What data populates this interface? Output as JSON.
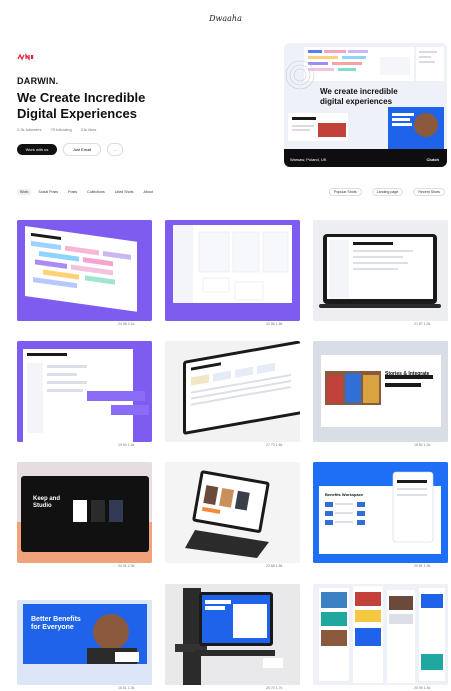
{
  "site": {
    "logo": "Dwaaha"
  },
  "profile": {
    "brand_name": "DARWIN.",
    "headline_line1": "We Create Incredible",
    "headline_line2": "Digital Experiences",
    "stats": [
      "2.3k followers",
      "75 following",
      "21k likes"
    ],
    "follow_label": "Work with us",
    "secondary_label": "Just Email",
    "more_label": "...",
    "accent": "#e5243b"
  },
  "hero": {
    "title": "We create incredible digital experiences",
    "caption": "Warsaw, Poland, UK",
    "tag": "Clutch"
  },
  "tabs": [
    "Work",
    "Social Posts",
    "Posts",
    "Collections",
    "Liked Shots",
    "About"
  ],
  "active_tab": "Work",
  "right_pills": [
    "Popular Shots",
    "Landing page",
    "Recent Shots"
  ],
  "shots": [
    {
      "stats": "24  98  2.1k"
    },
    {
      "stats": "32  86  1.8k"
    },
    {
      "stats": "21  57  1.3k"
    },
    {
      "stats": "19  64  1.4k"
    },
    {
      "stats": "27  73  1.6k"
    },
    {
      "stats": "16  52  1.2k"
    },
    {
      "stats": "34  91  2.3k"
    },
    {
      "stats": "22  66  1.5k"
    },
    {
      "stats": "29  81  1.9k"
    },
    {
      "stats": "18  61  1.3k"
    },
    {
      "stats": "25  70  1.7k"
    },
    {
      "stats": "20  59  1.4k"
    }
  ],
  "tile_texts": {
    "shot7_title": "Keep and Studio",
    "shot9_title": "Benefits Workspace",
    "shot10_title": "Better Benefits for Everyone",
    "shot6_title": "Stories & Integrate"
  }
}
